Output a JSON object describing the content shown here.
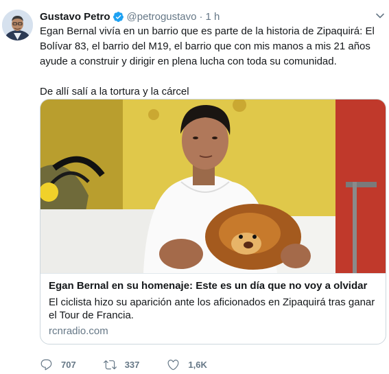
{
  "author": {
    "name": "Gustavo Petro",
    "handle": "@petrogustavo",
    "separator": "·",
    "time": "1 h"
  },
  "tweet": {
    "paragraph1": "Egan Bernal vivía en un barrio que es parte de la historia de Zipaquirá: El Bolívar 83, el barrio del M19, el barrio que con mis manos a mis 21 años ayude a construir y dirigir en plena lucha con toda su comunidad.",
    "paragraph2": "De allí salí a la tortura y la cárcel"
  },
  "card": {
    "title": "Egan Bernal en su homenaje: Este es un día que no voy a olvidar",
    "description": "El ciclista hizo su aparición ante los aficionados en Zipaquirá tras ganar el Tour de Francia.",
    "domain": "rcnradio.com"
  },
  "actions": {
    "replies": "707",
    "retweets": "337",
    "likes": "1,6K"
  },
  "colors": {
    "text": "#14171a",
    "secondary": "#657786",
    "verified": "#1da1f2",
    "border": "#ccd6dd"
  },
  "icons": [
    "verified-badge-icon",
    "chevron-down-icon",
    "reply-icon",
    "retweet-icon",
    "like-icon"
  ]
}
